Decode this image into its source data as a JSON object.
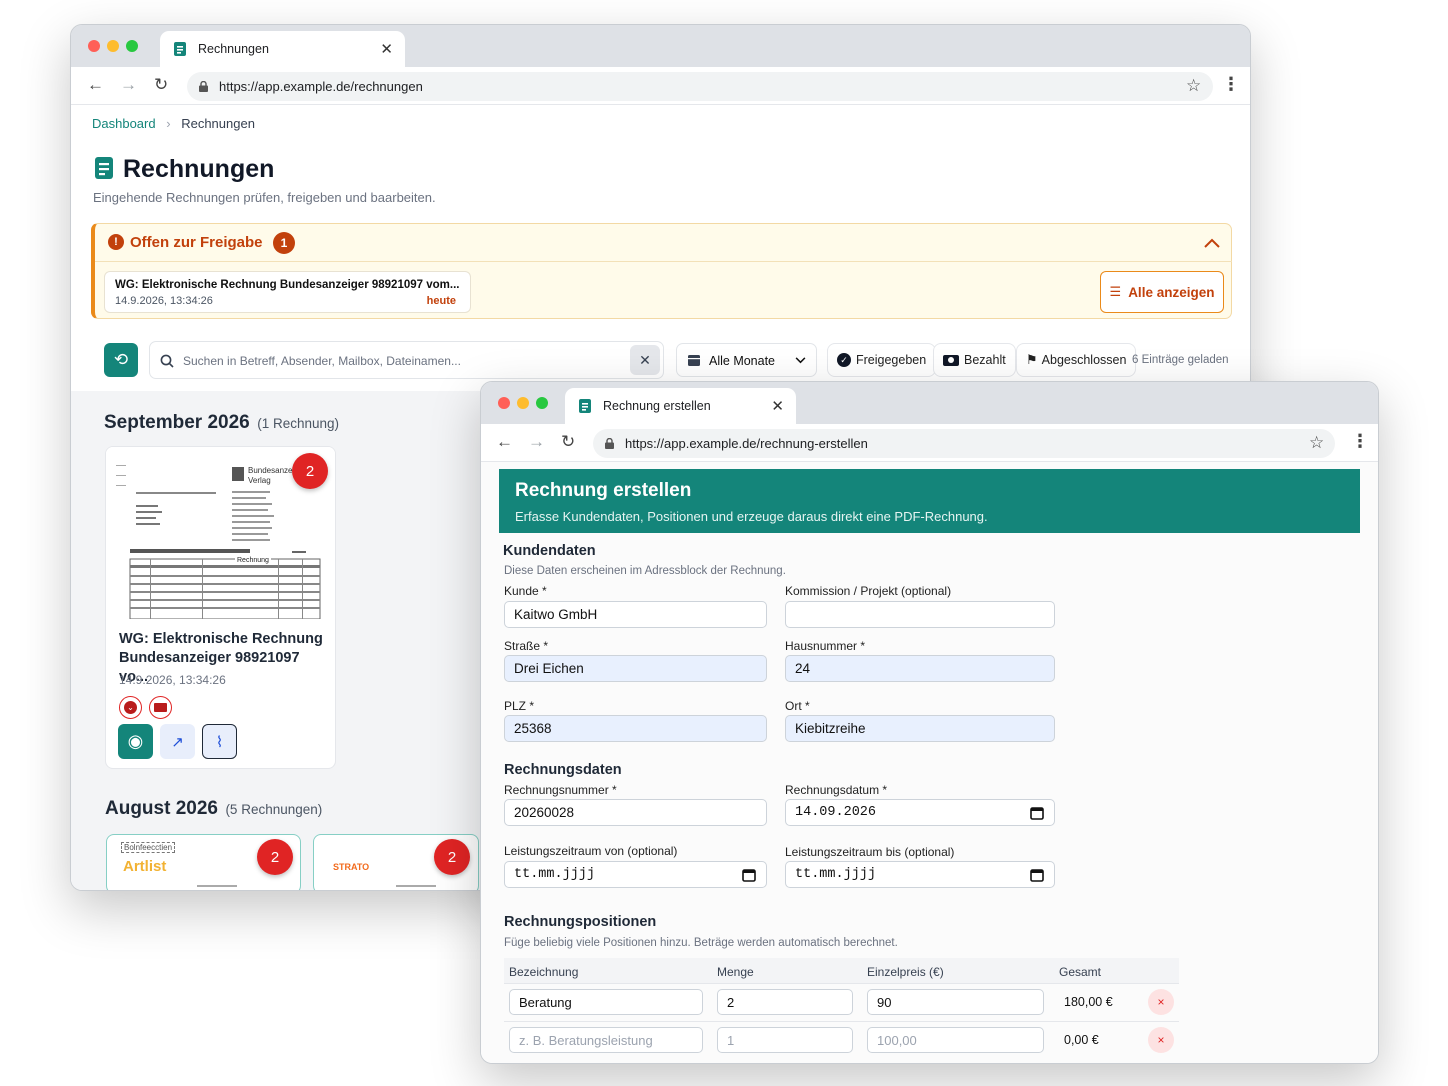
{
  "back_window": {
    "tab_title": "Rechnungen",
    "url": "https://app.example.de/rechnungen",
    "breadcrumb": {
      "home": "Dashboard",
      "separator": "›",
      "current": "Rechnungen"
    },
    "page_title": "Rechnungen",
    "page_subtitle": "Eingehende Rechnungen prüfen, freigeben und baarbeiten.",
    "pending": {
      "title": "Offen zur Freigabe",
      "count": "1",
      "item_title": "WG: Elektronische Rechnung Bundesanzeiger 98921097 vom...",
      "item_date": "14.9.2026, 13:34:26",
      "item_tag": "heute",
      "show_all_label": "Alle anzeigen"
    },
    "toolbar": {
      "search_placeholder": "Suchen in Betreff, Absender, Mailbox, Dateinamen...",
      "month_select": "Alle Monate",
      "filter_released": "Freigegeben",
      "filter_paid": "Bezahlt",
      "filter_closed": "Abgeschlossen",
      "loaded_count": "6 Einträge geladen"
    },
    "groups": [
      {
        "month": "September 2026",
        "count_label": "(1 Rechnung)"
      },
      {
        "month": "August 2026",
        "count_label": "(5 Rechnungen)"
      }
    ],
    "card": {
      "badge": "2",
      "title": "WG: Elektronische Rechnung Bundesanzeiger 98921097 vo...",
      "date": "14.9.2026, 13:34:26",
      "thumb_logo": "Bundesanzeiger Verlag",
      "thumb_word": "Rechnung"
    },
    "august_cards": [
      {
        "badge": "2",
        "logo": "Artlist",
        "stamp": "Bolnfeecctien"
      },
      {
        "badge": "2",
        "logo": "STRATO"
      }
    ]
  },
  "front_window": {
    "tab_title": "Rechnung erstellen",
    "url": "https://app.example.de/rechnung-erstellen",
    "banner_title": "Rechnung erstellen",
    "banner_subtitle": "Erfasse Kundendaten, Positionen und erzeuge daraus direkt eine PDF-Rechnung.",
    "customer": {
      "section": "Kundendaten",
      "hint": "Diese Daten erscheinen im Adressblock der Rechnung.",
      "kunde_label": "Kunde *",
      "kunde_value": "Kaitwo GmbH",
      "kommission_label": "Kommission / Projekt (optional)",
      "kommission_value": "",
      "strasse_label": "Straße *",
      "strasse_value": "Drei Eichen",
      "hausnummer_label": "Hausnummer *",
      "hausnummer_value": "24",
      "plz_label": "PLZ *",
      "plz_value": "25368",
      "ort_label": "Ort *",
      "ort_value": "Kiebitzreihe"
    },
    "invoice": {
      "section": "Rechnungsdaten",
      "nummer_label": "Rechnungsnummer *",
      "nummer_value": "20260028",
      "datum_label": "Rechnungsdatum *",
      "datum_value": "14.09.2026",
      "von_label": "Leistungszeitraum von (optional)",
      "von_value": "tt.mm.jjjj",
      "bis_label": "Leistungszeitraum bis (optional)",
      "bis_value": "tt.mm.jjjj"
    },
    "positions": {
      "section": "Rechnungspositionen",
      "hint": "Füge beliebig viele Positionen hinzu. Beträge werden automatisch berechnet.",
      "headers": [
        "Bezeichnung",
        "Menge",
        "Einzelpreis (€)",
        "Gesamt"
      ],
      "rows": [
        {
          "bezeichnung": "Beratung",
          "menge": "2",
          "preis": "90",
          "gesamt": "180,00 €",
          "placeholder": false
        },
        {
          "bezeichnung": "z. B. Beratungsleistung",
          "menge": "1",
          "preis": "100,00",
          "gesamt": "0,00 €",
          "placeholder": true
        }
      ],
      "remove_symbol": "×"
    }
  },
  "colors": {
    "brand_teal": "#14857a",
    "warning_orange": "#c2410c",
    "badge_red": "#e02424"
  }
}
